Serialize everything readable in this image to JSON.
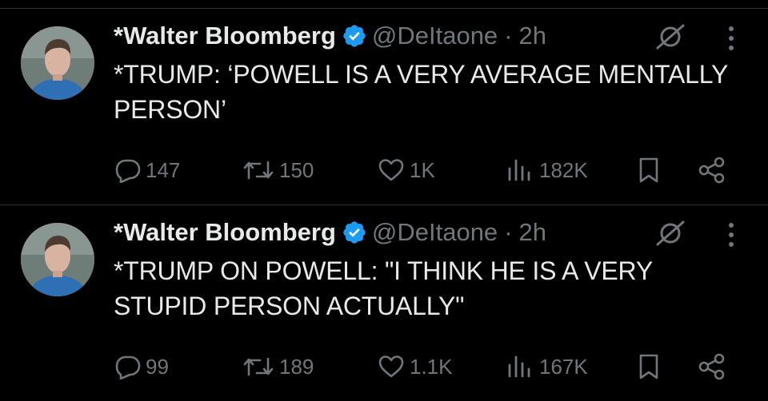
{
  "colors": {
    "background": "#000000",
    "text_primary": "#e7e9ea",
    "text_secondary": "#71767b",
    "divider": "#2f3336",
    "verified_blue": "#1d9bf0"
  },
  "tweets": [
    {
      "author": {
        "name": "*Walter Bloomberg",
        "handle": "@DeItaone",
        "verified": true
      },
      "dot": "·",
      "time": "2h",
      "text": "*TRUMP: ‘POWELL IS A VERY AVERAGE MENTALLY PERSON’",
      "stats": {
        "replies": "147",
        "retweets": "150",
        "likes": "1K",
        "views": "182K"
      }
    },
    {
      "author": {
        "name": "*Walter Bloomberg",
        "handle": "@DeItaone",
        "verified": true
      },
      "dot": "·",
      "time": "2h",
      "text": "*TRUMP ON POWELL: \"I THINK HE IS A VERY STUPID PERSON ACTUALLY\"",
      "stats": {
        "replies": "99",
        "retweets": "189",
        "likes": "1.1K",
        "views": "167K"
      }
    }
  ],
  "icons": {
    "verified": "verified-badge-icon",
    "mute": "mute-icon",
    "more": "more-options-icon",
    "reply": "reply-icon",
    "retweet": "retweet-icon",
    "like": "heart-icon",
    "views": "views-bar-chart-icon",
    "bookmark": "bookmark-icon",
    "share": "share-icon"
  }
}
